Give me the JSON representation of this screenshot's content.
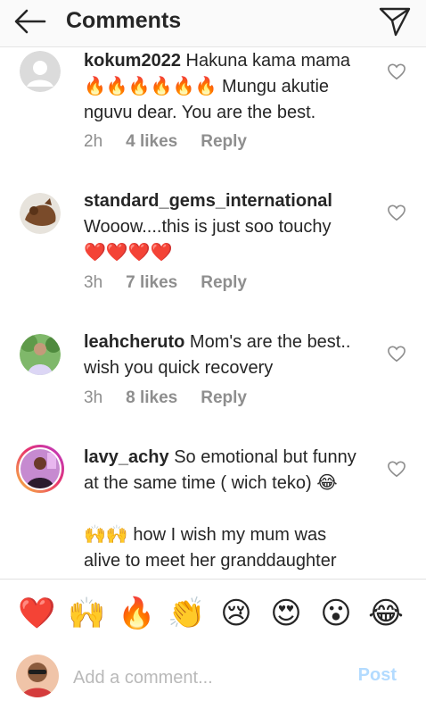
{
  "header": {
    "title": "Comments"
  },
  "comments": [
    {
      "username": "kokum2022",
      "text_lines": [
        "Hakuna kama mama",
        "🔥🔥🔥🔥🔥🔥 Mungu akutie",
        "nguvu dear. You are the best."
      ],
      "time": "2h",
      "likes": "4 likes",
      "reply": "Reply"
    },
    {
      "username": "standard_gems_international",
      "text_lines": [
        "Wooow....this is just soo touchy",
        "❤️❤️❤️❤️"
      ],
      "time": "3h",
      "likes": "7 likes",
      "reply": "Reply"
    },
    {
      "username": "leahcheruto",
      "text_lines": [
        "Mom's are the best..",
        "wish you quick recovery"
      ],
      "time": "3h",
      "likes": "8 likes",
      "reply": "Reply"
    },
    {
      "username": "lavy_achy",
      "text_lines": [
        "So emotional but funny",
        "at the same time ( wich teko) 😂",
        "",
        "🙌🙌 how I wish my mum was",
        "alive to meet her granddaughter"
      ]
    }
  ],
  "emoji_bar": [
    "❤️",
    "🙌",
    "🔥",
    "👏",
    "😢",
    "😍",
    "😮",
    "😂"
  ],
  "input": {
    "placeholder": "Add a comment...",
    "post_label": "Post"
  },
  "colors": {
    "post_disabled": "#b3dbff",
    "meta_gray": "#8e8e8e",
    "heart_red": "#ed4956"
  }
}
